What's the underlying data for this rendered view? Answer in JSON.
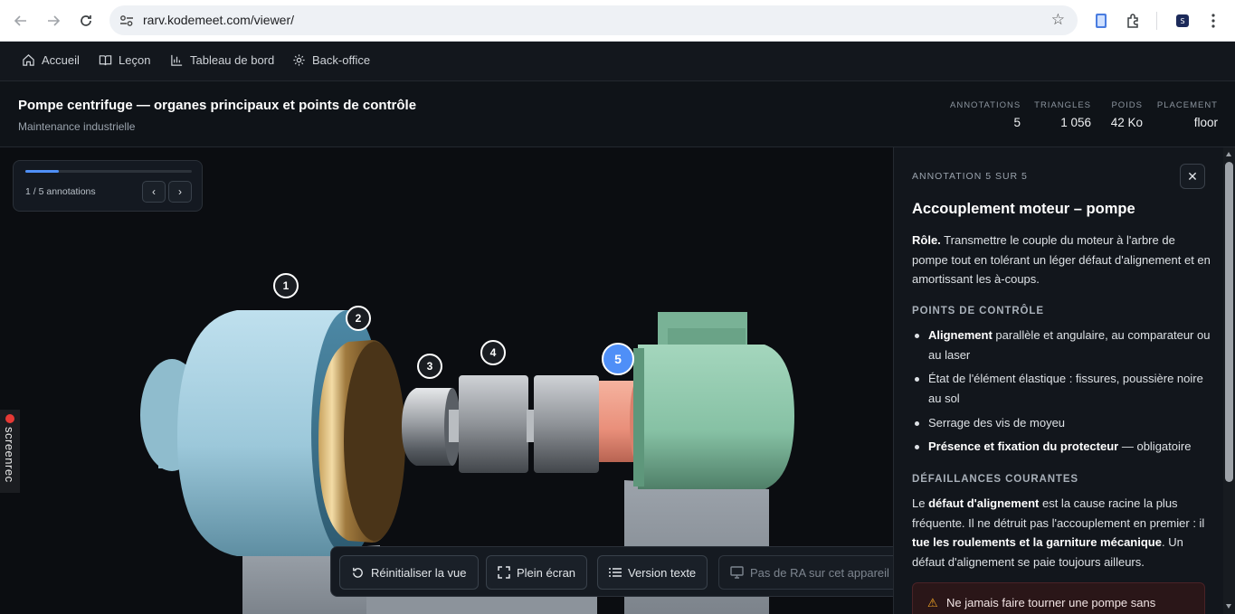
{
  "browser": {
    "url": "rarv.kodemeet.com/viewer/"
  },
  "nav": {
    "items": [
      {
        "label": "Accueil",
        "icon": "home-icon"
      },
      {
        "label": "Leçon",
        "icon": "book-icon"
      },
      {
        "label": "Tableau de bord",
        "icon": "bar-chart-icon"
      },
      {
        "label": "Back-office",
        "icon": "gear-icon"
      }
    ]
  },
  "header": {
    "title": "Pompe centrifuge — organes principaux et points de contrôle",
    "subtitle": "Maintenance industrielle",
    "stats": [
      {
        "label": "ANNOTATIONS",
        "value": "5"
      },
      {
        "label": "TRIANGLES",
        "value": "1 056"
      },
      {
        "label": "POIDS",
        "value": "42 Ko"
      },
      {
        "label": "PLACEMENT",
        "value": "floor"
      }
    ]
  },
  "progress": {
    "text": "1 / 5 annotations",
    "fraction": 0.2
  },
  "markers": [
    "1",
    "2",
    "3",
    "4",
    "5"
  ],
  "toolbar": {
    "reset": "Réinitialiser la vue",
    "fullscreen": "Plein écran",
    "text_version": "Version texte",
    "ar": "Pas de RA sur cet appareil"
  },
  "screenrec": "screenrec",
  "panel": {
    "overline": "ANNOTATION 5 SUR 5",
    "title": "Accouplement moteur – pompe",
    "role_label": "Rôle.",
    "role_text": " Transmettre le couple du moteur à l'arbre de pompe tout en tolérant un léger défaut d'alignement et en amortissant les à-coups.",
    "checkpoints_heading": "POINTS DE CONTRÔLE",
    "checkpoints": {
      "c1_bold": "Alignement",
      "c1_rest": " parallèle et angulaire, au comparateur ou au laser",
      "c2": "État de l'élément élastique : fissures, poussière noire au sol",
      "c3": "Serrage des vis de moyeu",
      "c4_bold": "Présence et fixation du protecteur",
      "c4_rest": " — obligatoire"
    },
    "failures_heading": "DÉFAILLANCES COURANTES",
    "failures": {
      "p1": "Le ",
      "b1": "défaut d'alignement",
      "p2": " est la cause racine la plus fréquente. Il ne détruit pas l'accouplement en premier : il ",
      "b2": "tue les roulements et la garniture mécanique",
      "p3": ". Un défaut d'alignement se paie toujours ailleurs."
    },
    "warning": "Ne jamais faire tourner une pompe sans"
  },
  "colors": {
    "accent": "#4f8ff7",
    "pump_casing": "#a9d2e3",
    "motor": "#86c1a4",
    "coupling": "#e98f7a"
  }
}
